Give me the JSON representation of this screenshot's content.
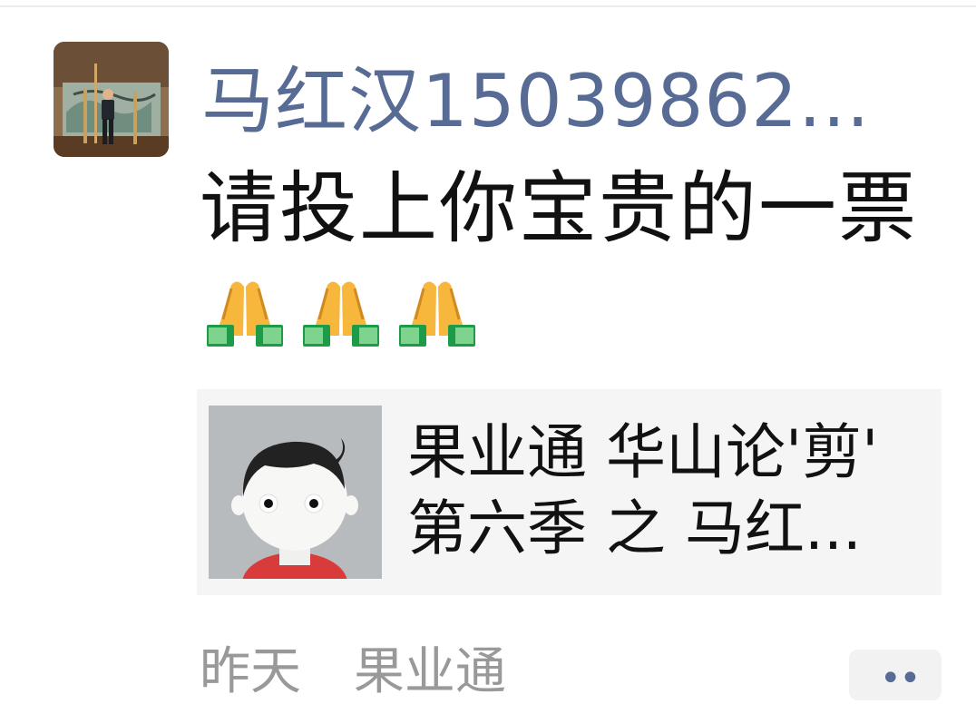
{
  "post": {
    "author_name": "马红汉15039862...",
    "text": "请投上你宝贵的一票",
    "emojis": [
      "folded-hands-emoji",
      "folded-hands-emoji",
      "folded-hands-emoji"
    ]
  },
  "link_card": {
    "title": "果业通 华山论'剪'\n第六季 之 马红..."
  },
  "footer": {
    "time": "昨天",
    "source": "果业通",
    "more_label": "••"
  },
  "colors": {
    "author_name": "#576b95",
    "card_bg": "#f5f5f5"
  }
}
